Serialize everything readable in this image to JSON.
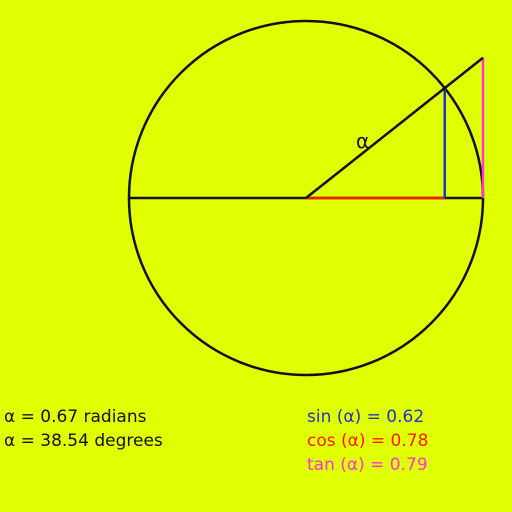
{
  "diagram": {
    "angle_label": "α",
    "angle_radians": 0.67,
    "colors": {
      "background": "#e0ff00",
      "circle": "#111111",
      "sin": "#2233cc",
      "cos": "#ff1a00",
      "tan": "#ff33dd"
    }
  },
  "readouts": {
    "radians": "α = 0.67 radians",
    "degrees": "α = 38.54 degrees",
    "sin": "sin (α) = 0.62",
    "cos": "cos (α) = 0.78",
    "tan": "tan (α) = 0.79"
  }
}
